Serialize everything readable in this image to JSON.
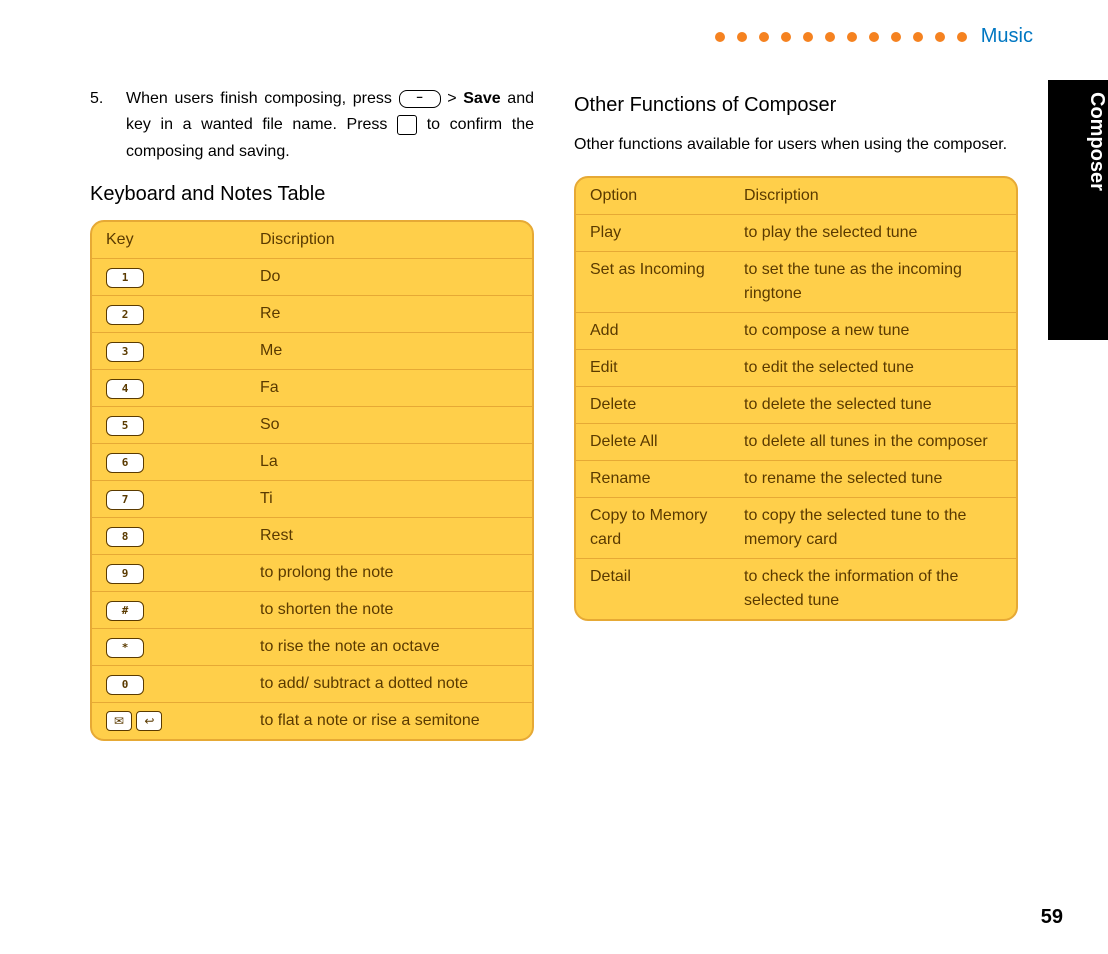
{
  "header": {
    "section": "Music",
    "sideTab": "Composer"
  },
  "step": {
    "num": "5.",
    "text_a": "When users finish composing, press ",
    "text_b": " > ",
    "save": "Save",
    "text_c": " and key in a wanted file name. Press ",
    "text_d": " to confirm the composing and saving."
  },
  "notesTable": {
    "title": "Keyboard and Notes Table",
    "head1": "Key",
    "head2": "Discription",
    "rows": [
      {
        "key": "1",
        "desc": "Do"
      },
      {
        "key": "2",
        "desc": "Re"
      },
      {
        "key": "3",
        "desc": "Me"
      },
      {
        "key": "4",
        "desc": "Fa"
      },
      {
        "key": "5",
        "desc": "So"
      },
      {
        "key": "6",
        "desc": "La"
      },
      {
        "key": "7",
        "desc": "Ti"
      },
      {
        "key": "8",
        "desc": "Rest"
      },
      {
        "key": "9",
        "desc": "to prolong the note"
      },
      {
        "key": "#",
        "desc": "to shorten the note"
      },
      {
        "key": "*",
        "desc": "to rise the note an octave"
      },
      {
        "key": "0",
        "desc": "to add/ subtract a dotted note"
      }
    ],
    "lastRow": {
      "icon1": "✉",
      "icon2": "↩",
      "desc": "to flat a note or rise a semitone"
    }
  },
  "other": {
    "title": "Other Functions of Composer",
    "intro": "Other functions available for users when using the composer.",
    "head1": "Option",
    "head2": "Discription",
    "rows": [
      {
        "opt": "Play",
        "desc": "to play the selected tune"
      },
      {
        "opt": "Set as Incoming",
        "desc": "to set the tune as the incoming ringtone"
      },
      {
        "opt": "Add",
        "desc": "to compose a new tune"
      },
      {
        "opt": "Edit",
        "desc": "to edit the selected tune"
      },
      {
        "opt": "Delete",
        "desc": "to delete the selected tune"
      },
      {
        "opt": "Delete All",
        "desc": "to delete all tunes in the composer"
      },
      {
        "opt": "Rename",
        "desc": "to rename the selected tune"
      },
      {
        "opt": "Copy to Memory card",
        "desc": "to copy the selected tune to the memory card"
      },
      {
        "opt": "Detail",
        "desc": "to check the information of the selected tune"
      }
    ]
  },
  "pageNumber": "59"
}
